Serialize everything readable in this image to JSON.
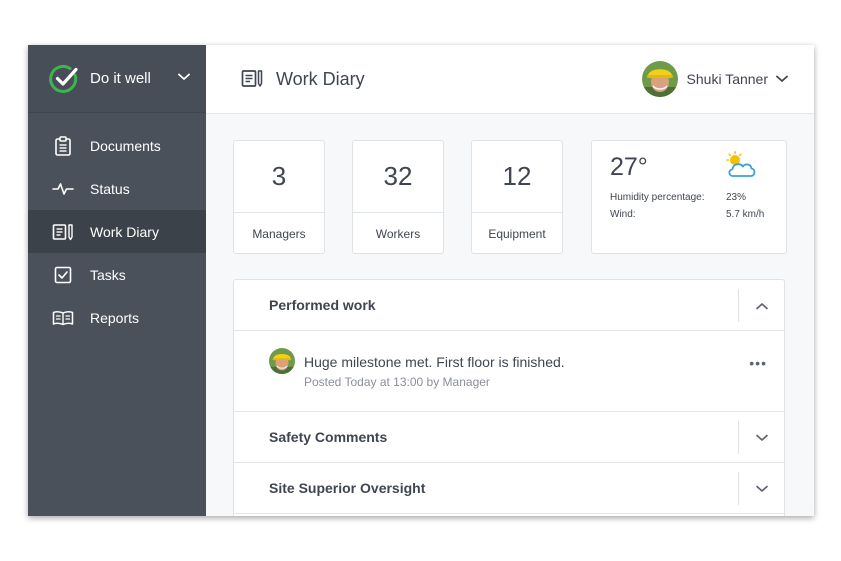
{
  "brand": {
    "name": "Do it well",
    "accent": "#3fb34f"
  },
  "sidebar": {
    "items": [
      {
        "label": "Documents",
        "icon": "clipboard-icon",
        "active": false
      },
      {
        "label": "Status",
        "icon": "pulse-icon",
        "active": false
      },
      {
        "label": "Work Diary",
        "icon": "diary-icon",
        "active": true
      },
      {
        "label": "Tasks",
        "icon": "checkbox-icon",
        "active": false
      },
      {
        "label": "Reports",
        "icon": "book-icon",
        "active": false
      }
    ]
  },
  "header": {
    "title": "Work Diary",
    "title_icon": "diary-icon"
  },
  "user": {
    "name": "Shuki Tanner"
  },
  "stats": [
    {
      "value": "3",
      "label": "Managers"
    },
    {
      "value": "32",
      "label": "Workers"
    },
    {
      "value": "12",
      "label": "Equipment"
    }
  ],
  "weather": {
    "temperature": "27°",
    "icon": "partly-cloudy-icon",
    "humidity_label": "Humidity percentage:",
    "humidity_value": "23%",
    "wind_label": "Wind:",
    "wind_value": "5.7 km/h"
  },
  "sections": [
    {
      "title": "Performed work",
      "expanded": true
    },
    {
      "title": "Safety Comments",
      "expanded": false
    },
    {
      "title": "Site Superior Oversight",
      "expanded": false
    }
  ],
  "post": {
    "text": "Huge milestone met. First floor is finished.",
    "meta": "Posted Today at 13:00 by Manager",
    "menu": "•••"
  }
}
